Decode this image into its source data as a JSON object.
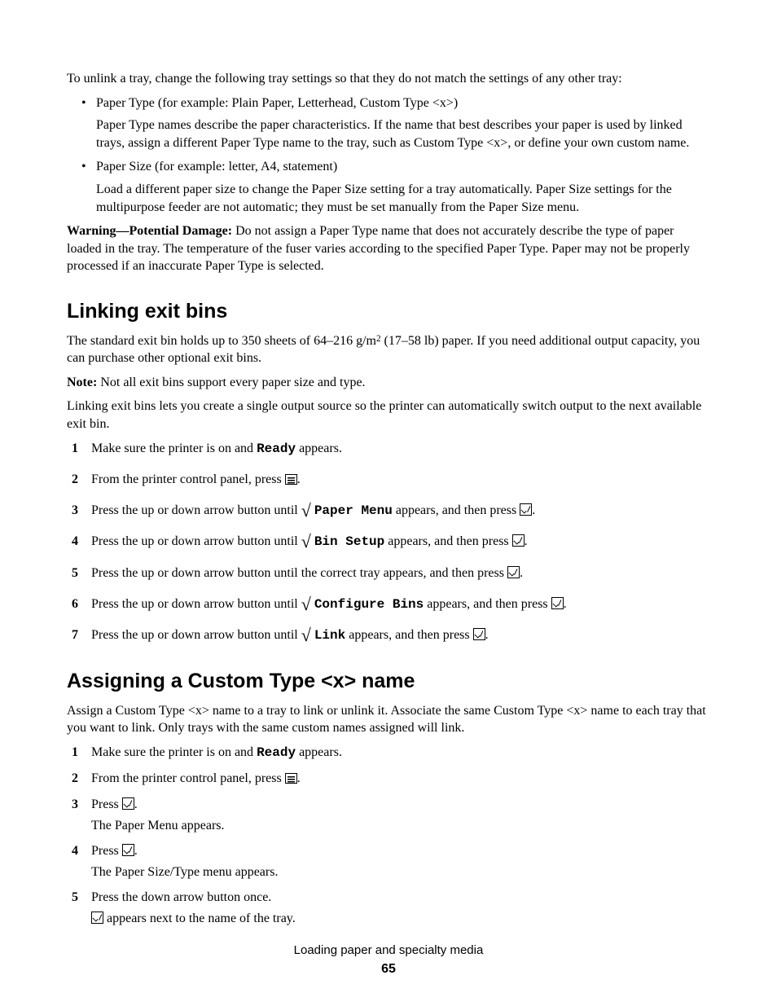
{
  "intro": "To unlink a tray, change the following tray settings so that they do not match the settings of any other tray:",
  "bullets": [
    {
      "head": "Paper Type (for example: Plain Paper, Letterhead, Custom Type <x>)",
      "body": "Paper Type names describe the paper characteristics. If the name that best describes your paper is used by linked trays, assign a different Paper Type name to the tray, such as Custom Type <x>, or define your own custom name."
    },
    {
      "head": "Paper Size (for example: letter, A4, statement)",
      "body": "Load a different paper size to change the Paper Size setting for a tray automatically. Paper Size settings for the multipurpose feeder are not automatic; they must be set manually from the Paper Size menu."
    }
  ],
  "warning_label": "Warning—Potential Damage:",
  "warning_body": " Do not assign a Paper Type name that does not accurately describe the type of paper loaded in the tray. The temperature of the fuser varies according to the specified Paper Type. Paper may not be properly processed if an inaccurate Paper Type is selected.",
  "sec1_title": "Linking exit bins",
  "sec1_p1_a": "The standard exit bin holds up to 350 sheets of 64–216 g/m",
  "sec1_p1_b": " (17–58 lb) paper. If you need additional output capacity, you can purchase other optional exit bins.",
  "note_label": "Note:",
  "sec1_note": " Not all exit bins support every paper size and type.",
  "sec1_p2": "Linking exit bins lets you create a single output source so the printer can automatically switch output to the next available exit bin.",
  "steps1": {
    "s1a": "Make sure the printer is on and ",
    "ready": "Ready",
    "s1b": " appears.",
    "s2a": "From the printer control panel, press ",
    "s3a": "Press the up or down arrow button until ",
    "paper_menu": "Paper Menu",
    "s3b": " appears, and then press ",
    "bin_setup": "Bin Setup",
    "s5": "Press the up or down arrow button until the correct tray appears, and then press ",
    "configure_bins": "Configure Bins",
    "link": "Link"
  },
  "sec2_title": "Assigning a Custom Type <x> name",
  "sec2_p1": "Assign a Custom Type <x> name to a tray to link or unlink it. Associate the same Custom Type <x> name to each tray that you want to link. Only trays with the same custom names assigned will link.",
  "steps2": {
    "s3": "Press ",
    "s3_sub": "The Paper Menu appears.",
    "s4_sub": "The Paper Size/Type menu appears.",
    "s5": "Press the down arrow button once.",
    "s5_sub": " appears next to the name of the tray."
  },
  "footer_title": "Loading paper and specialty media",
  "footer_page": "65"
}
